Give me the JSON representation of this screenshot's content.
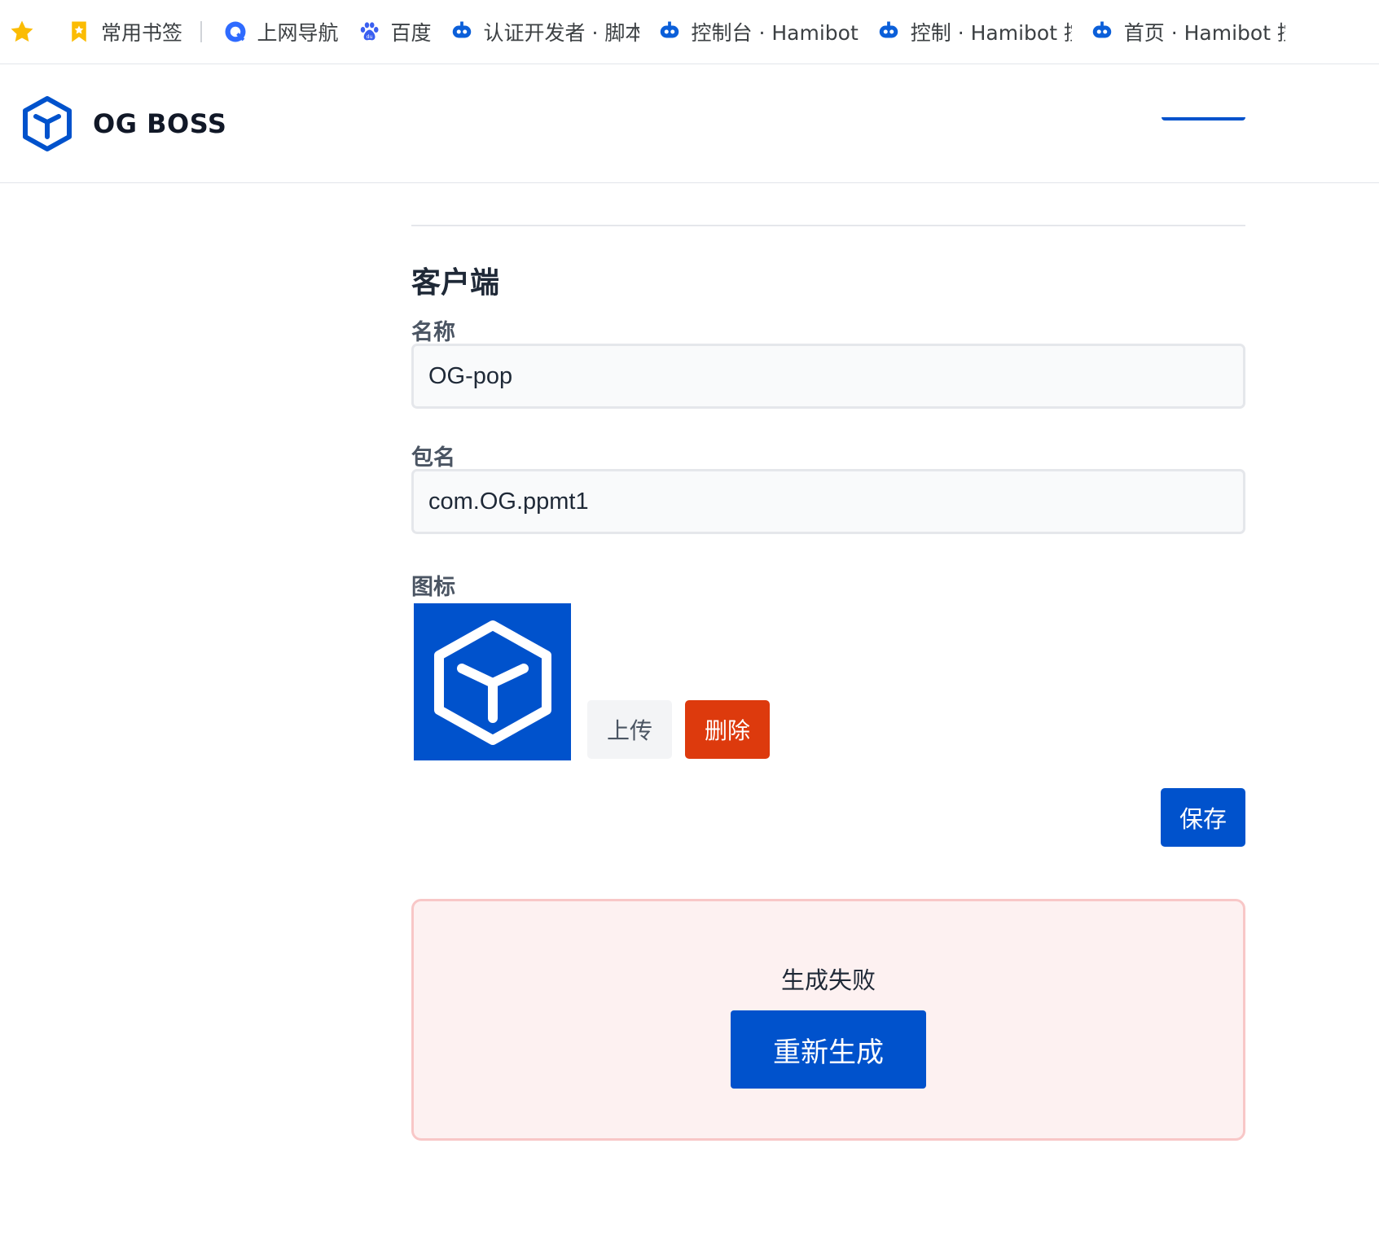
{
  "bookmarks": {
    "items": [
      {
        "label": "常用书签",
        "icon": "bookmark-icon"
      },
      {
        "label": "上网导航",
        "icon": "q-nav-icon"
      },
      {
        "label": "百度",
        "icon": "baidu-paw-icon"
      },
      {
        "label": "认证开发者 · 脚本",
        "icon": "hamibot-icon"
      },
      {
        "label": "控制台 · Hamibot",
        "icon": "hamibot-icon"
      },
      {
        "label": "控制 · Hamibot 控",
        "icon": "hamibot-icon"
      },
      {
        "label": "首页 · Hamibot 控",
        "icon": "hamibot-icon"
      }
    ]
  },
  "header": {
    "brand": "OG BOSS",
    "logo_icon": "cube-icon"
  },
  "client": {
    "section_title": "客户端",
    "name_label": "名称",
    "name_value": "OG-pop",
    "package_label": "包名",
    "package_value": "com.OG.ppmt1",
    "icon_label": "图标",
    "icon_image": "cube-icon",
    "upload_label": "上传",
    "delete_label": "删除",
    "save_label": "保存"
  },
  "build": {
    "status_text": "生成失败",
    "regenerate_label": "重新生成"
  },
  "colors": {
    "primary": "#0052cc",
    "danger": "#dd3a0d",
    "error_bg": "#fdf1f1",
    "error_border": "#f8c7c7"
  }
}
